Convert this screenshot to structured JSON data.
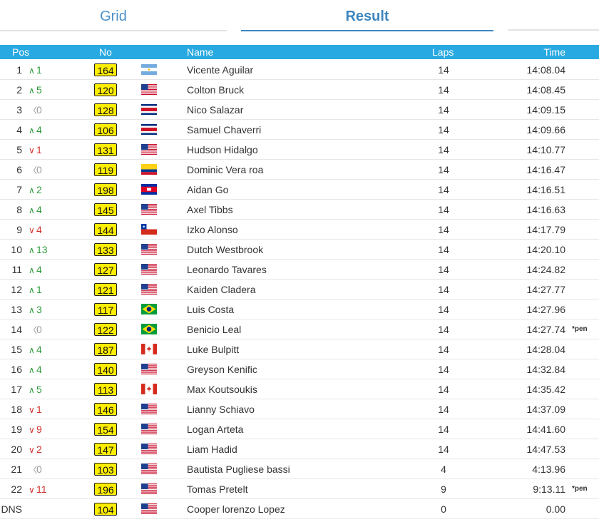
{
  "tabs": {
    "grid_label": "Grid",
    "result_label": "Result"
  },
  "table": {
    "headers": {
      "pos": "Pos",
      "no": "No",
      "name": "Name",
      "laps": "Laps",
      "time": "Time"
    },
    "rows": [
      {
        "pos": "1",
        "change": "1",
        "dir": "up",
        "no": "164",
        "flag": "argentina",
        "name": "Vicente Aguilar",
        "laps": "14",
        "time": "14:08.04",
        "note": ""
      },
      {
        "pos": "2",
        "change": "5",
        "dir": "up",
        "no": "120",
        "flag": "usa",
        "name": "Colton Bruck",
        "laps": "14",
        "time": "14:08.45",
        "note": ""
      },
      {
        "pos": "3",
        "change": "0",
        "dir": "same",
        "no": "128",
        "flag": "costa-rica",
        "name": "Nico Salazar",
        "laps": "14",
        "time": "14:09.15",
        "note": ""
      },
      {
        "pos": "4",
        "change": "4",
        "dir": "up",
        "no": "106",
        "flag": "costa-rica",
        "name": "Samuel Chaverri",
        "laps": "14",
        "time": "14:09.66",
        "note": ""
      },
      {
        "pos": "5",
        "change": "1",
        "dir": "down",
        "no": "131",
        "flag": "usa",
        "name": "Hudson Hidalgo",
        "laps": "14",
        "time": "14:10.77",
        "note": ""
      },
      {
        "pos": "6",
        "change": "0",
        "dir": "same",
        "no": "119",
        "flag": "colombia",
        "name": "Dominic Vera roa",
        "laps": "14",
        "time": "14:16.47",
        "note": ""
      },
      {
        "pos": "7",
        "change": "2",
        "dir": "up",
        "no": "198",
        "flag": "cambodia",
        "name": "Aidan Go",
        "laps": "14",
        "time": "14:16.51",
        "note": ""
      },
      {
        "pos": "8",
        "change": "4",
        "dir": "up",
        "no": "145",
        "flag": "usa",
        "name": "Axel Tibbs",
        "laps": "14",
        "time": "14:16.63",
        "note": ""
      },
      {
        "pos": "9",
        "change": "4",
        "dir": "down",
        "no": "144",
        "flag": "chile",
        "name": "Izko Alonso",
        "laps": "14",
        "time": "14:17.79",
        "note": ""
      },
      {
        "pos": "10",
        "change": "13",
        "dir": "up",
        "no": "133",
        "flag": "usa",
        "name": "Dutch Westbrook",
        "laps": "14",
        "time": "14:20.10",
        "note": ""
      },
      {
        "pos": "11",
        "change": "4",
        "dir": "up",
        "no": "127",
        "flag": "usa",
        "name": "Leonardo Tavares",
        "laps": "14",
        "time": "14:24.82",
        "note": ""
      },
      {
        "pos": "12",
        "change": "1",
        "dir": "up",
        "no": "121",
        "flag": "usa",
        "name": "Kaiden Cladera",
        "laps": "14",
        "time": "14:27.77",
        "note": ""
      },
      {
        "pos": "13",
        "change": "3",
        "dir": "up",
        "no": "117",
        "flag": "brazil",
        "name": "Luis Costa",
        "laps": "14",
        "time": "14:27.96",
        "note": ""
      },
      {
        "pos": "14",
        "change": "0",
        "dir": "same",
        "no": "122",
        "flag": "brazil",
        "name": "Benicio Leal",
        "laps": "14",
        "time": "14:27.74",
        "note": "*pen"
      },
      {
        "pos": "15",
        "change": "4",
        "dir": "up",
        "no": "187",
        "flag": "canada",
        "name": "Luke Bulpitt",
        "laps": "14",
        "time": "14:28.04",
        "note": ""
      },
      {
        "pos": "16",
        "change": "4",
        "dir": "up",
        "no": "140",
        "flag": "usa",
        "name": "Greyson Kenific",
        "laps": "14",
        "time": "14:32.84",
        "note": ""
      },
      {
        "pos": "17",
        "change": "5",
        "dir": "up",
        "no": "113",
        "flag": "canada",
        "name": "Max Koutsoukis",
        "laps": "14",
        "time": "14:35.42",
        "note": ""
      },
      {
        "pos": "18",
        "change": "1",
        "dir": "down",
        "no": "146",
        "flag": "usa",
        "name": "Lianny Schiavo",
        "laps": "14",
        "time": "14:37.09",
        "note": ""
      },
      {
        "pos": "19",
        "change": "9",
        "dir": "down",
        "no": "154",
        "flag": "usa",
        "name": "Logan Arteta",
        "laps": "14",
        "time": "14:41.60",
        "note": ""
      },
      {
        "pos": "20",
        "change": "2",
        "dir": "down",
        "no": "147",
        "flag": "usa",
        "name": "Liam Hadid",
        "laps": "14",
        "time": "14:47.53",
        "note": ""
      },
      {
        "pos": "21",
        "change": "0",
        "dir": "same",
        "no": "103",
        "flag": "usa",
        "name": "Bautista Pugliese bassi",
        "laps": "4",
        "time": "4:13.96",
        "note": ""
      },
      {
        "pos": "22",
        "change": "11",
        "dir": "down",
        "no": "196",
        "flag": "usa",
        "name": "Tomas Pretelt",
        "laps": "9",
        "time": "9:13.11",
        "note": "*pen"
      },
      {
        "pos": "DNS",
        "change": "",
        "dir": "none",
        "no": "104",
        "flag": "usa",
        "name": "Cooper lorenzo Lopez",
        "laps": "0",
        "time": "0.00",
        "note": ""
      }
    ]
  },
  "colors": {
    "header_bg": "#29a9e1",
    "tab_active": "#3d86bf",
    "number_plate": "#ffee00",
    "change_up": "#2e9b3c",
    "change_down": "#d0312d",
    "change_same": "#999999"
  }
}
